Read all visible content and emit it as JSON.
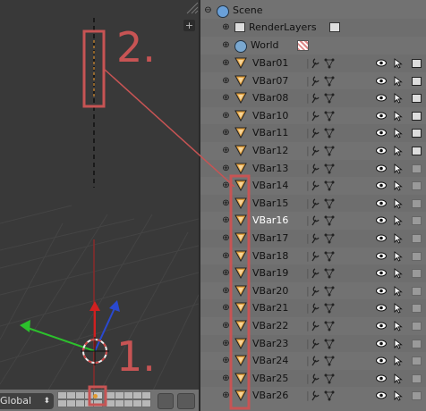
{
  "viewport": {
    "plus_label": "+"
  },
  "header": {
    "mode_label": "Global",
    "mode_arrow": "⬍"
  },
  "outliner": {
    "scene_label": "Scene",
    "renderlayers_label": "RenderLayers",
    "world_label": "World",
    "objects": [
      {
        "name": "VBar01",
        "highlight": false,
        "cam_dim": false
      },
      {
        "name": "VBar07",
        "highlight": false,
        "cam_dim": false
      },
      {
        "name": "VBar08",
        "highlight": false,
        "cam_dim": false
      },
      {
        "name": "VBar10",
        "highlight": false,
        "cam_dim": false
      },
      {
        "name": "VBar11",
        "highlight": false,
        "cam_dim": false
      },
      {
        "name": "VBar12",
        "highlight": false,
        "cam_dim": false
      },
      {
        "name": "VBar13",
        "highlight": false,
        "cam_dim": true
      },
      {
        "name": "VBar14",
        "highlight": false,
        "cam_dim": true
      },
      {
        "name": "VBar15",
        "highlight": false,
        "cam_dim": true
      },
      {
        "name": "VBar16",
        "highlight": true,
        "cam_dim": true
      },
      {
        "name": "VBar17",
        "highlight": false,
        "cam_dim": true
      },
      {
        "name": "VBar18",
        "highlight": false,
        "cam_dim": true
      },
      {
        "name": "VBar19",
        "highlight": false,
        "cam_dim": true
      },
      {
        "name": "VBar20",
        "highlight": false,
        "cam_dim": true
      },
      {
        "name": "VBar21",
        "highlight": false,
        "cam_dim": true
      },
      {
        "name": "VBar22",
        "highlight": false,
        "cam_dim": true
      },
      {
        "name": "VBar23",
        "highlight": false,
        "cam_dim": true
      },
      {
        "name": "VBar24",
        "highlight": false,
        "cam_dim": true
      },
      {
        "name": "VBar25",
        "highlight": false,
        "cam_dim": true
      },
      {
        "name": "VBar26",
        "highlight": false,
        "cam_dim": true
      }
    ]
  },
  "annotations": {
    "one": "1.",
    "two": "2.",
    "color": "#c75454"
  },
  "icons": {
    "expand": "⊕",
    "eye": "👁",
    "cursor": "⇱",
    "object": "triangle-mesh",
    "modifier": "wrench",
    "vertices": "vertex-triple"
  }
}
